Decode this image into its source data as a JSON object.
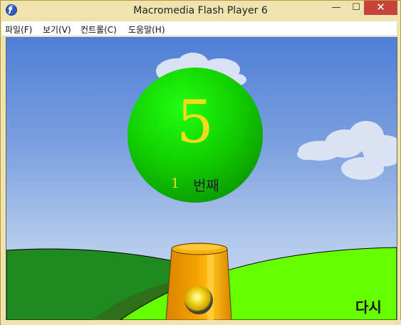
{
  "window": {
    "title": "Macromedia Flash Player 6",
    "minimize_glyph": "—",
    "maximize_glyph": "☐",
    "close_glyph": "✕"
  },
  "menu": {
    "items": [
      {
        "label": "파일(F)"
      },
      {
        "label": "보기(V)"
      },
      {
        "label": "컨트롤(C)"
      },
      {
        "label": "도움말(H)"
      }
    ]
  },
  "game": {
    "ball_number": "5",
    "round_count": "1",
    "round_suffix": "번째",
    "retry_label": "다시",
    "colors": {
      "ball": "#11c800",
      "number": "#f2dc1a",
      "cannon": "#f5a000",
      "hill_front": "#66ff00",
      "hill_back": "#1f8a1f"
    }
  }
}
